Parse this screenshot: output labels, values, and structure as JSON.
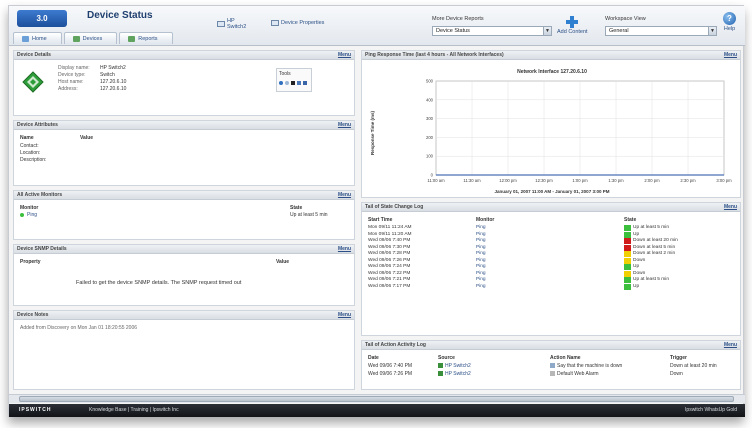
{
  "app": {
    "logo_text": "3.0",
    "page_title": "Device Status"
  },
  "nav": {
    "tabs": [
      {
        "label": "Home",
        "icon": "home-icon",
        "color": "#6b9fd8"
      },
      {
        "label": "Devices",
        "icon": "devices-icon",
        "color": "#5fa35f"
      },
      {
        "label": "Reports",
        "icon": "reports-icon",
        "color": "#5fa35f"
      }
    ]
  },
  "toolbar": {
    "hp_switch_line1": "HP",
    "hp_switch_line2": "Switch2",
    "device_properties": "Device Properties",
    "more_reports_label": "More Device Reports",
    "more_reports_value": "Device Status",
    "add_content": "Add Content",
    "workspace_label": "Workspace View",
    "workspace_value": "General",
    "help": "Help"
  },
  "device_details": {
    "title": "Device Details",
    "menu": "Menu",
    "fields": [
      {
        "label": "Display name:",
        "value": "HP Switch2"
      },
      {
        "label": "Device type:",
        "value": "Switch"
      },
      {
        "label": "Host name:",
        "value": "127.20.6.10"
      },
      {
        "label": "Address:",
        "value": "127.20.6.10"
      }
    ],
    "tools_label": "Tools"
  },
  "device_attributes": {
    "title": "Device Attributes",
    "menu": "Menu",
    "col_name": "Name",
    "col_value": "Value",
    "rows": [
      "Contact:",
      "Location:",
      "Description:"
    ]
  },
  "active_monitors": {
    "title": "All Active Monitors",
    "menu": "Menu",
    "col_monitor": "Monitor",
    "col_state": "State",
    "rows": [
      {
        "monitor": "Ping",
        "state": "Up at least 5 min",
        "color": "#3cbf3c"
      }
    ]
  },
  "snmp": {
    "title": "Device SNMP Details",
    "menu": "Menu",
    "col_property": "Property",
    "col_value": "Value",
    "message": "Failed to get the device SNMP details. The SNMP request timed out"
  },
  "notes": {
    "title": "Device Notes",
    "menu": "Menu",
    "text": "Added from Discovery on Mon Jan 01 18:20:55 2006"
  },
  "ping_chart": {
    "title": "Ping Response Time (last 4 hours - All Network Interfaces)",
    "menu": "Menu",
    "chart_title": "Network Interface 127.20.6.10",
    "ylabel": "Response Time (ms)",
    "xlabel": "January 01, 2007 11:00 AM - January 01, 2007 3:00 PM",
    "y_ticks": [
      "0",
      "100",
      "200",
      "300",
      "400",
      "500"
    ],
    "x_ticks": [
      "11:00 am",
      "11:30 am",
      "12:00 pm",
      "12:30 pm",
      "1:00 pm",
      "1:30 pm",
      "2:00 pm",
      "2:30 pm",
      "3:00 pm"
    ]
  },
  "chart_data": {
    "type": "line",
    "title": "Network Interface 127.20.6.10",
    "xlabel": "January 01, 2007 11:00 AM - January 01, 2007 3:00 PM",
    "ylabel": "Response Time (ms)",
    "categories": [
      "11:00 am",
      "11:30 am",
      "12:00 pm",
      "12:30 pm",
      "1:00 pm",
      "1:30 pm",
      "2:00 pm",
      "2:30 pm",
      "3:00 pm"
    ],
    "ylim": [
      0,
      500
    ],
    "series": [
      {
        "values": [
          0,
          0,
          0,
          0,
          0,
          0,
          0,
          0,
          0
        ]
      }
    ],
    "grid": true
  },
  "state_log": {
    "title": "Tail of State Change Log",
    "menu": "Menu",
    "col_start": "Start Time",
    "col_monitor": "Monitor",
    "col_state": "State",
    "rows": [
      {
        "time": "Mon 09/11 11:24 AM",
        "monitor": "Ping",
        "state": "Up at least 5 min",
        "color": "#3cbf3c"
      },
      {
        "time": "Mon 09/11 11:20 AM",
        "monitor": "Ping",
        "state": "Up",
        "color": "#3cbf3c"
      },
      {
        "time": "Wed 09/06 7:40 PM",
        "monitor": "Ping",
        "state": "Down at least 20 min",
        "color": "#d11b1b"
      },
      {
        "time": "Wed 09/06 7:30 PM",
        "monitor": "Ping",
        "state": "Down at least 5 min",
        "color": "#d11b1b"
      },
      {
        "time": "Wed 09/06 7:28 PM",
        "monitor": "Ping",
        "state": "Down at least 2 min",
        "color": "#f0d000"
      },
      {
        "time": "Wed 09/06 7:26 PM",
        "monitor": "Ping",
        "state": "Down",
        "color": "#f0d000"
      },
      {
        "time": "Wed 09/06 7:24 PM",
        "monitor": "Ping",
        "state": "Up",
        "color": "#3cbf3c"
      },
      {
        "time": "Wed 09/06 7:22 PM",
        "monitor": "Ping",
        "state": "Down",
        "color": "#f0d000"
      },
      {
        "time": "Wed 09/06 7:21 PM",
        "monitor": "Ping",
        "state": "Up at least 5 min",
        "color": "#3cbf3c"
      },
      {
        "time": "Wed 09/06 7:17 PM",
        "monitor": "Ping",
        "state": "Up",
        "color": "#3cbf3c"
      }
    ]
  },
  "action_log": {
    "title": "Tail of Action Activity Log",
    "menu": "Menu",
    "col_date": "Date",
    "col_source": "Source",
    "col_action": "Action Name",
    "col_trigger": "Trigger",
    "rows": [
      {
        "date": "Wed 09/06 7:40 PM",
        "source": "HP Switch2",
        "action": "Say that the machine is down",
        "trigger": "Down at least 20 min"
      },
      {
        "date": "Wed 09/06 7:26 PM",
        "source": "HP Switch2",
        "action": "Default Web Alarm",
        "trigger": "Down"
      }
    ]
  },
  "footer": {
    "brand": "IPSWITCH",
    "links": "Knowledge Base  |  Training  |  Ipswitch Inc",
    "right": "Ipswitch WhatsUp Gold"
  }
}
